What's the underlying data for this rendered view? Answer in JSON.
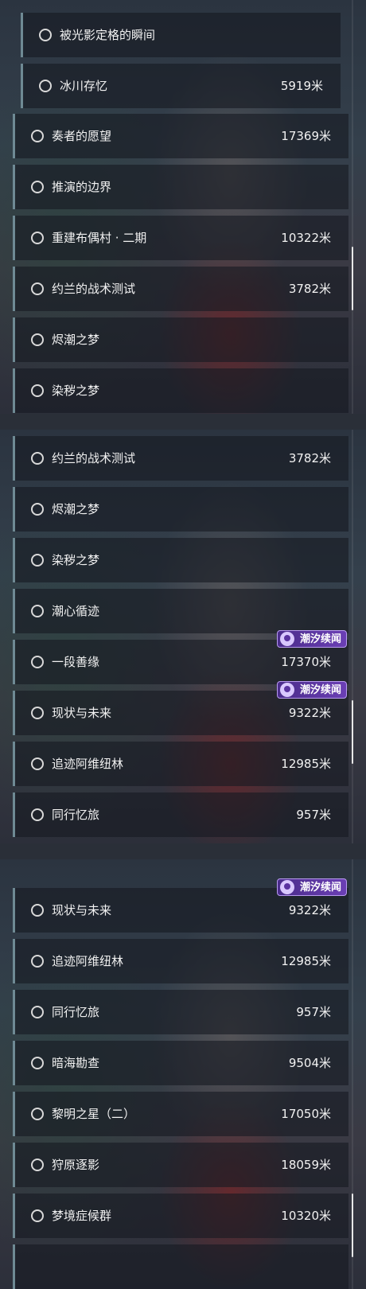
{
  "unit": "米",
  "badge_label": "潮汐续闻",
  "panels": [
    {
      "rows": [
        {
          "name": "被光影定格的瞬间",
          "dist": ""
        },
        {
          "name": "冰川存忆",
          "dist": "5919米"
        },
        {
          "name": "奏者的愿望",
          "dist": "17369米"
        },
        {
          "name": "推演的边界",
          "dist": ""
        },
        {
          "name": "重建布偶村 · 二期",
          "dist": "10322米"
        },
        {
          "name": "约兰的战术测试",
          "dist": "3782米"
        },
        {
          "name": "烬潮之梦",
          "dist": ""
        },
        {
          "name": "染秽之梦",
          "dist": ""
        }
      ]
    },
    {
      "rows": [
        {
          "name": "约兰的战术测试",
          "dist": "3782米"
        },
        {
          "name": "烬潮之梦",
          "dist": ""
        },
        {
          "name": "染秽之梦",
          "dist": ""
        },
        {
          "name": "潮心循迹",
          "dist": ""
        },
        {
          "name": "一段善缘",
          "dist": "17370米",
          "badge": true
        },
        {
          "name": "现状与未来",
          "dist": "9322米",
          "badge": true
        },
        {
          "name": "追迹阿维纽林",
          "dist": "12985米"
        },
        {
          "name": "同行忆旅",
          "dist": "957米"
        }
      ]
    },
    {
      "rows": [
        {
          "name": "现状与未来",
          "dist": "9322米",
          "badge": true
        },
        {
          "name": "追迹阿维纽林",
          "dist": "12985米"
        },
        {
          "name": "同行忆旅",
          "dist": "957米"
        },
        {
          "name": "暗海勘查",
          "dist": "9504米"
        },
        {
          "name": "黎明之星（二）",
          "dist": "17050米"
        },
        {
          "name": "狩原逐影",
          "dist": "18059米"
        },
        {
          "name": "梦境症候群",
          "dist": "10320米"
        }
      ]
    }
  ]
}
